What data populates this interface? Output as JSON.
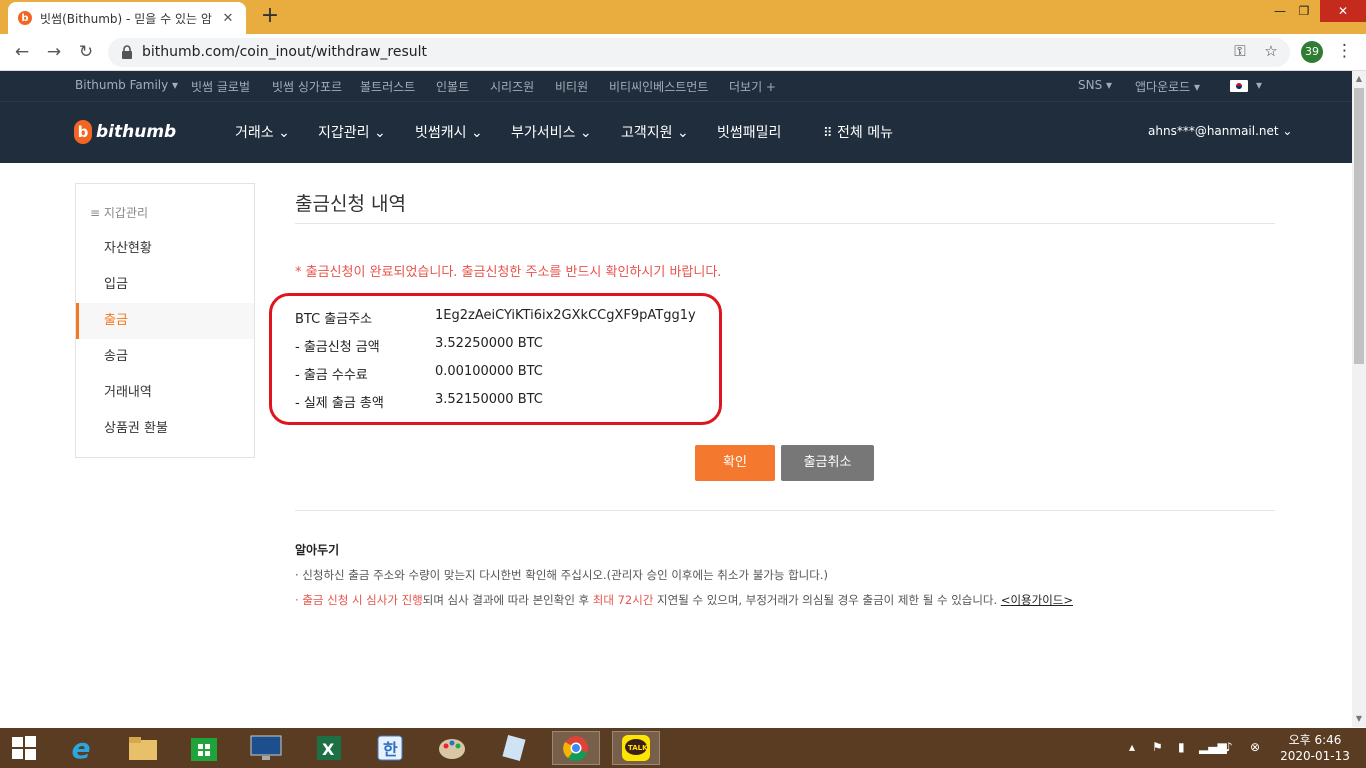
{
  "browser": {
    "tab_title": "빗썸(Bithumb) - 믿을 수 있는 암",
    "url": "bithumb.com/coin_inout/withdraw_result",
    "profile_badge": "39"
  },
  "topbar": {
    "items": [
      "Bithumb Family ▾",
      "빗썸 글로벌",
      "빗썸 싱가포르",
      "볼트러스트",
      "인볼트",
      "시리즈원",
      "비티원",
      "비티씨인베스트먼트",
      "더보기 +"
    ],
    "sns": "SNS ▾",
    "app_download": "앱다운로드 ▾",
    "lang": "▾"
  },
  "nav": {
    "logo": "bithumb",
    "items": [
      "거래소 ⌄",
      "지갑관리 ⌄",
      "빗썸캐시 ⌄",
      "부가서비스 ⌄",
      "고객지원 ⌄",
      "빗썸패밀리",
      "전체 메뉴"
    ],
    "user": "ahns***@hanmail.net ⌄"
  },
  "sidebar": {
    "header": "지갑관리",
    "items": [
      "자산현황",
      "입금",
      "출금",
      "송금",
      "거래내역",
      "상품권 환불"
    ]
  },
  "content": {
    "title": "출금신청 내역",
    "notice": "* 출금신청이 완료되었습니다. 출금신청한 주소를 반드시 확인하시기 바랍니다.",
    "rows": [
      {
        "label": "BTC 출금주소",
        "value": "1Eg2zAeiCYiKTi6ix2GXkCCgXF9pATgg1y"
      },
      {
        "label": "- 출금신청 금액",
        "value": "3.52250000 BTC"
      },
      {
        "label": "- 출금 수수료",
        "value": "0.00100000 BTC"
      },
      {
        "label": "- 실제 출금 총액",
        "value": "3.52150000 BTC"
      }
    ],
    "confirm": "확인",
    "cancel": "출금취소"
  },
  "info": {
    "title": "알아두기",
    "line1": "· 신청하신 출금 주소와 수량이 맞는지 다시한번 확인해 주십시오.(관리자 승인 이후에는 취소가 불가능 합니다.)",
    "line2_a": "· ",
    "line2_b": "출금 신청 시 심사가 진행",
    "line2_c": "되며 심사 결과에 따라 본인확인 후 ",
    "line2_d": "최대 72시간",
    "line2_e": " 지연될 수 있으며, 부정거래가 의심될 경우 출금이 제한 될 수 있습니다. ",
    "line2_link": "<이용가이드>"
  },
  "taskbar": {
    "time": "오후 6:46",
    "date": "2020-01-13"
  },
  "colors": {
    "accent": "#f47920",
    "alert": "#e8534b",
    "highlight_box": "#e0141e",
    "header_bg": "#1f2d3d"
  }
}
